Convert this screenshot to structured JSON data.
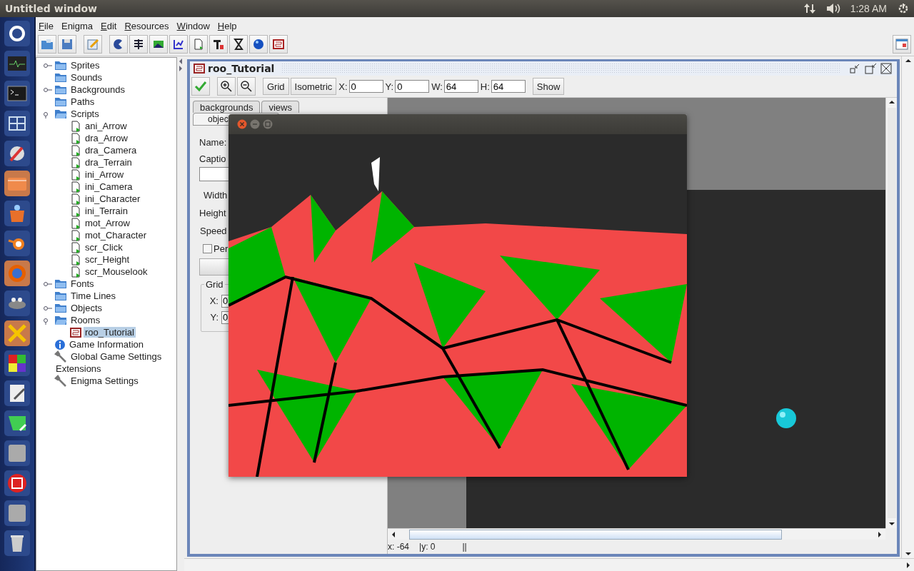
{
  "top_bar": {
    "title": "Untitled window",
    "clock": "1:28 AM"
  },
  "menu": [
    {
      "label": "File",
      "mnemonic": true
    },
    {
      "label": "Enigma",
      "mnemonic": false
    },
    {
      "label": "Edit",
      "mnemonic": true
    },
    {
      "label": "Resources",
      "mnemonic": true
    },
    {
      "label": "Window",
      "mnemonic": true
    },
    {
      "label": "Help",
      "mnemonic": true
    }
  ],
  "tree": [
    {
      "label": "Sprites",
      "kind": "folder",
      "expanded": false,
      "selected": false
    },
    {
      "label": "Sounds",
      "kind": "folder",
      "selected": false
    },
    {
      "label": "Backgrounds",
      "kind": "folder",
      "expanded": false,
      "selected": false
    },
    {
      "label": "Paths",
      "kind": "folder",
      "selected": false
    },
    {
      "label": "Scripts",
      "kind": "folder",
      "expanded": true,
      "selected": false,
      "children": [
        {
          "label": "ani_Arrow",
          "kind": "script",
          "selected": false
        },
        {
          "label": "dra_Arrow",
          "kind": "script",
          "selected": false
        },
        {
          "label": "dra_Camera",
          "kind": "script",
          "selected": false
        },
        {
          "label": "dra_Terrain",
          "kind": "script",
          "selected": false
        },
        {
          "label": "ini_Arrow",
          "kind": "script",
          "selected": false
        },
        {
          "label": "ini_Camera",
          "kind": "script",
          "selected": false
        },
        {
          "label": "ini_Character",
          "kind": "script",
          "selected": false
        },
        {
          "label": "ini_Terrain",
          "kind": "script",
          "selected": false
        },
        {
          "label": "mot_Arrow",
          "kind": "script",
          "selected": false
        },
        {
          "label": "mot_Character",
          "kind": "script",
          "selected": false
        },
        {
          "label": "scr_Click",
          "kind": "script",
          "selected": false
        },
        {
          "label": "scr_Height",
          "kind": "script",
          "selected": false
        },
        {
          "label": "scr_Mouselook",
          "kind": "script",
          "selected": false
        }
      ]
    },
    {
      "label": "Fonts",
      "kind": "folder",
      "expanded": false,
      "selected": false
    },
    {
      "label": "Time Lines",
      "kind": "folder",
      "selected": false
    },
    {
      "label": "Objects",
      "kind": "folder",
      "expanded": false,
      "selected": false
    },
    {
      "label": "Rooms",
      "kind": "folder",
      "expanded": true,
      "selected": false,
      "children": [
        {
          "label": "roo_Tutorial",
          "kind": "room",
          "selected": true
        }
      ]
    },
    {
      "label": "Game Information",
      "kind": "info",
      "selected": false
    },
    {
      "label": "Global Game Settings",
      "kind": "settings",
      "selected": false
    },
    {
      "label": "Extensions",
      "kind": "plain",
      "selected": false
    },
    {
      "label": "Enigma Settings",
      "kind": "settings",
      "selected": false
    }
  ],
  "room_editor": {
    "title": "roo_Tutorial",
    "toggles": [
      {
        "label": "Grid",
        "selected": false
      },
      {
        "label": "Isometric",
        "selected": false
      }
    ],
    "fields": [
      {
        "label": "X:",
        "value": "0"
      },
      {
        "label": "Y:",
        "value": "0"
      },
      {
        "label": "W:",
        "value": "64"
      },
      {
        "label": "H:",
        "value": "64"
      }
    ],
    "show_button": "Show",
    "tabs_back": [
      {
        "label": "backgrounds",
        "selected": false
      },
      {
        "label": "views",
        "selected": false
      }
    ],
    "tabs_front": [
      {
        "label": "objec",
        "selected": true
      }
    ],
    "form_labels": [
      "Name:",
      "Captio"
    ],
    "size_labels": [
      "Width",
      "Height",
      "Speed"
    ],
    "checkbox": {
      "label": "Per",
      "checked": false
    },
    "grid_group": {
      "title": "Grid",
      "fields": [
        {
          "label": "X:",
          "value": "0"
        },
        {
          "label": "Y:",
          "value": "0"
        }
      ]
    },
    "status": [
      "x: -64",
      "|y: 0",
      "||"
    ]
  }
}
